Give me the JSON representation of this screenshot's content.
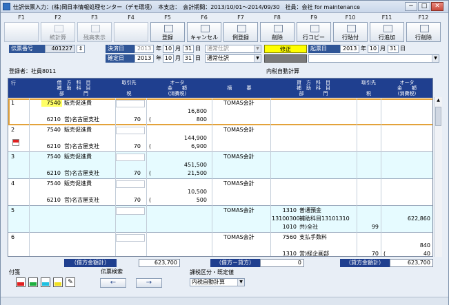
{
  "window": {
    "title": "仕訳伝票入力：(株)岡日本情報処理センター（デモ環境）　本支店：　会計期間：2013/10/01〜2014/09/30　社員：会社 for maintenance",
    "min": "─",
    "max": "□",
    "close": "✕"
  },
  "fkeys": [
    {
      "key": "F1",
      "label": "",
      "on": false
    },
    {
      "key": "F2",
      "label": "統計算",
      "on": false
    },
    {
      "key": "F3",
      "label": "残高表示",
      "on": false
    },
    {
      "key": "F4",
      "label": "",
      "on": false
    },
    {
      "key": "F5",
      "label": "登録",
      "on": true
    },
    {
      "key": "F6",
      "label": "キャンセル",
      "on": true
    },
    {
      "key": "F7",
      "label": "例登録",
      "on": true
    },
    {
      "key": "F8",
      "label": "削除",
      "on": true
    },
    {
      "key": "F9",
      "label": "行コピー",
      "on": true
    },
    {
      "key": "F10",
      "label": "行貼付",
      "on": true
    },
    {
      "key": "F11",
      "label": "行追加",
      "on": true
    },
    {
      "key": "F12",
      "label": "行削除",
      "on": true
    }
  ],
  "header": {
    "slip_no_label": "伝票番号",
    "slip_no": "401227",
    "settle_label": "決済日",
    "settle_year": "2013",
    "settle_month": "10",
    "settle_day": "31",
    "confirm_label": "確定日",
    "confirm_year": "2013",
    "confirm_month": "10",
    "confirm_day": "31",
    "year_unit": "年",
    "month_unit": "月",
    "day_unit": "日",
    "type1": "通常仕訳",
    "type2": "通常仕訳",
    "edit_status": "修正",
    "issue_label": "起票日",
    "issue_year": "2013",
    "issue_month": "10",
    "issue_day": "31",
    "registrant": "登録者：社員8011",
    "mode": "内税自動計算"
  },
  "grid_head": {
    "row": "行",
    "debit_acct": "借　方　科　目",
    "debit_sub": "補　助　科　目",
    "debit_dept": "部　　　　門",
    "partner": "取引先",
    "tax": "税",
    "amount_title": "オータ",
    "amount": "金　　額",
    "amount_tax": "(消費税)",
    "memo": "摘　　　要",
    "credit_acct": "貸　方　科　目",
    "credit_sub": "補　助　科　目",
    "credit_dept": "部　　　　門",
    "c_partner": "取引先",
    "c_tax": "税",
    "c_amount_title": "オータ",
    "c_amount": "金　　額",
    "c_amount_tax": "(消費税)"
  },
  "rows": [
    {
      "no": "1",
      "acct_code": "7540",
      "acct": "販売促進費",
      "dept_code": "6210",
      "dept": "営)名古屋支社",
      "tax": "70",
      "amount": "16,800",
      "tax_amt": "800",
      "memo": "TOMAS会計",
      "c_code": "",
      "c_acct": "",
      "c_sub_code": "",
      "c_sub": "",
      "c_dept_code": "",
      "c_dept": "",
      "c_tax": "",
      "c_amount": "",
      "c_tax_amt": ""
    },
    {
      "no": "2",
      "acct_code": "7540",
      "acct": "販売促進費",
      "dept_code": "6210",
      "dept": "営)名古屋支社",
      "tax": "70",
      "amount": "144,900",
      "tax_amt": "6,900",
      "memo": "TOMAS会計",
      "c_code": "",
      "c_acct": "",
      "c_sub_code": "",
      "c_sub": "",
      "c_dept_code": "",
      "c_dept": "",
      "c_tax": "",
      "c_amount": "",
      "c_tax_amt": ""
    },
    {
      "no": "3",
      "acct_code": "7540",
      "acct": "販売促進費",
      "dept_code": "6210",
      "dept": "営)名古屋支社",
      "tax": "70",
      "amount": "451,500",
      "tax_amt": "21,500",
      "memo": "TOMAS会計",
      "c_code": "",
      "c_acct": "",
      "c_sub_code": "",
      "c_sub": "",
      "c_dept_code": "",
      "c_dept": "",
      "c_tax": "",
      "c_amount": "",
      "c_tax_amt": ""
    },
    {
      "no": "4",
      "acct_code": "7540",
      "acct": "販売促進費",
      "dept_code": "6210",
      "dept": "営)名古屋支社",
      "tax": "70",
      "amount": "10,500",
      "tax_amt": "500",
      "memo": "TOMAS会計",
      "c_code": "",
      "c_acct": "",
      "c_sub_code": "",
      "c_sub": "",
      "c_dept_code": "",
      "c_dept": "",
      "c_tax": "",
      "c_amount": "",
      "c_tax_amt": ""
    },
    {
      "no": "5",
      "acct_code": "",
      "acct": "",
      "dept_code": "",
      "dept": "",
      "tax": "",
      "amount": "",
      "tax_amt": "",
      "memo": "TOMAS会計",
      "c_code": "1310",
      "c_acct": "普通預金",
      "c_sub_code": "13100300",
      "c_sub": "補助科目13101310",
      "c_dept_code": "1010",
      "c_dept": "共)全社",
      "c_tax": "99",
      "c_amount": "622,860",
      "c_tax_amt": ""
    },
    {
      "no": "6",
      "acct_code": "",
      "acct": "",
      "dept_code": "",
      "dept": "",
      "tax": "",
      "amount": "",
      "tax_amt": "",
      "memo": "TOMAS会計",
      "c_code": "7560",
      "c_acct": "支払手数料",
      "c_sub_code": "",
      "c_sub": "",
      "c_dept_code": "1310",
      "c_dept": "営)経企画部",
      "c_tax": "70",
      "c_amount": "840",
      "c_tax_amt": "40"
    }
  ],
  "totals": {
    "debit_label": "（借方金額計）",
    "debit": "623,700",
    "diff_label": "（借方－貸方）",
    "diff": "0",
    "credit_label": "（貸方金額計）",
    "credit": "623,700"
  },
  "bottom": {
    "tag_label": "付箋",
    "search_label": "伝票検索",
    "prev": "←",
    "next": "→",
    "tax_label": "課税区分・既定値",
    "tax_mode": "内税自動計算"
  }
}
